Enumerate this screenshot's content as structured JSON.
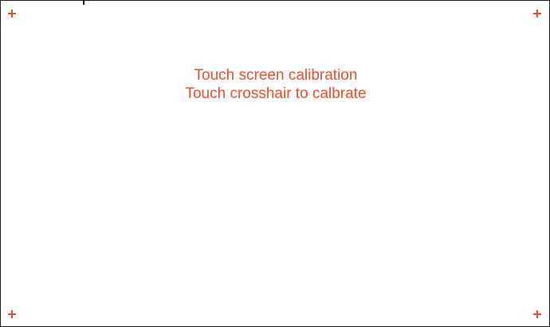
{
  "calibration": {
    "title": "Touch screen calibration",
    "instruction": "Touch crosshair to calbrate",
    "accent_color": "#ee4a2c",
    "targets": [
      {
        "id": "top-left",
        "icon": "crosshair-icon"
      },
      {
        "id": "top-right",
        "icon": "crosshair-icon"
      },
      {
        "id": "bottom-left",
        "icon": "crosshair-icon"
      },
      {
        "id": "bottom-right",
        "icon": "crosshair-icon"
      }
    ]
  }
}
